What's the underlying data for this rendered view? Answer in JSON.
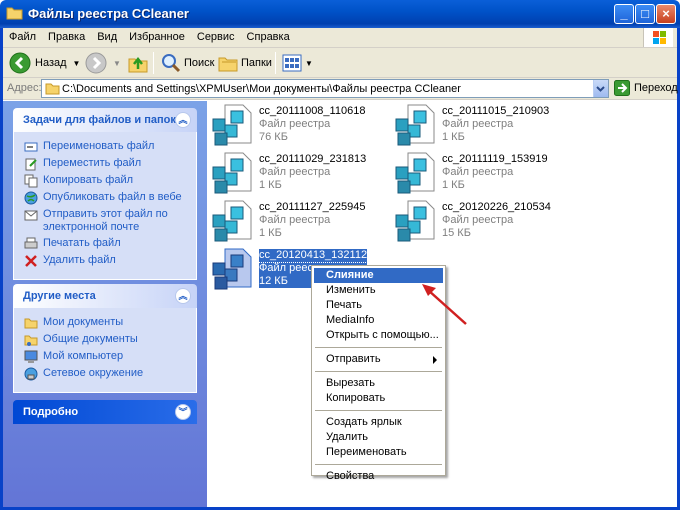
{
  "window": {
    "title": "Файлы реестра CCleaner"
  },
  "menu": [
    "Файл",
    "Правка",
    "Вид",
    "Избранное",
    "Сервис",
    "Справка"
  ],
  "toolbar": {
    "back": "Назад",
    "search": "Поиск",
    "folders": "Папки"
  },
  "address": {
    "label": "Адрес:",
    "path": "C:\\Documents and Settings\\XPMUser\\Мои документы\\Файлы реестра CCleaner",
    "go": "Переход"
  },
  "tasks": {
    "title": "Задачи для файлов и папок",
    "items": [
      "Переименовать файл",
      "Переместить файл",
      "Копировать файл",
      "Опубликовать файл в вебе",
      "Отправить этот файл по электронной почте",
      "Печатать файл",
      "Удалить файл"
    ]
  },
  "places": {
    "title": "Другие места",
    "items": [
      "Мои документы",
      "Общие документы",
      "Мой компьютер",
      "Сетевое окружение"
    ]
  },
  "details": {
    "title": "Подробно"
  },
  "files": [
    {
      "name": "cc_20111008_110618",
      "type": "Файл реестра",
      "size": "76 КБ"
    },
    {
      "name": "cc_20111015_210903",
      "type": "Файл реестра",
      "size": "1 КБ"
    },
    {
      "name": "cc_20111029_231813",
      "type": "Файл реестра",
      "size": "1 КБ"
    },
    {
      "name": "cc_20111119_153919",
      "type": "Файл реестра",
      "size": "1 КБ"
    },
    {
      "name": "cc_20111127_225945",
      "type": "Файл реестра",
      "size": "1 КБ"
    },
    {
      "name": "cc_20120226_210534",
      "type": "Файл реестра",
      "size": "15 КБ"
    },
    {
      "name": "cc_20120413_132112",
      "type": "Файл реестра",
      "size": "12 КБ"
    }
  ],
  "context_menu": {
    "group1": [
      "Слияние",
      "Изменить",
      "Печать",
      "MediaInfo",
      "Открыть с помощью..."
    ],
    "group2": [
      "Отправить"
    ],
    "group3": [
      "Вырезать",
      "Копировать"
    ],
    "group4": [
      "Создать ярлык",
      "Удалить",
      "Переименовать"
    ],
    "group5": [
      "Свойства"
    ]
  },
  "colors": {
    "titlebar": "#0052c8",
    "taskpane": "#7ba2e7",
    "selection": "#316ac5",
    "link": "#215dc6"
  }
}
